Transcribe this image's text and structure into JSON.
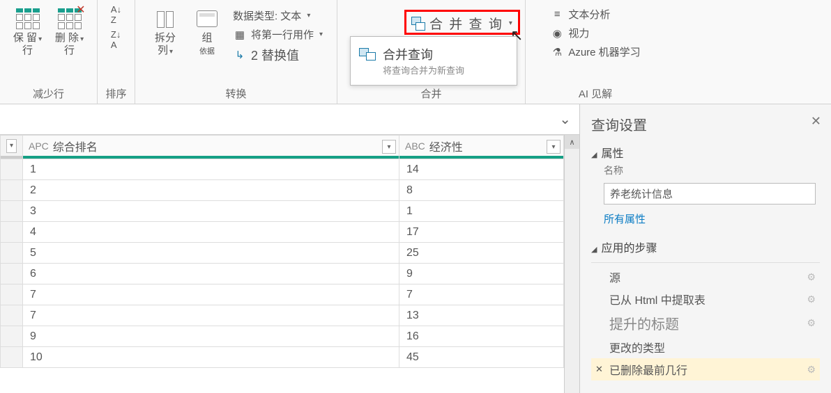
{
  "ribbon": {
    "groups": {
      "reduce": {
        "keep_rows": "保 留",
        "remove_rows": "删 除",
        "row_suffix": "行",
        "label": "减少行"
      },
      "sort": {
        "label": "排序"
      },
      "columns": {
        "split": "拆分",
        "col": "列",
        "group": "组",
        "group_suffix": "依据"
      },
      "transform": {
        "datatype": "数据类型: 文本",
        "first_row": "将第一行用作",
        "replace": "2 替换值",
        "label": "转换"
      },
      "merge": {
        "btn": "合 并 查 询",
        "dd_title": "合并查询",
        "dd_sub": "将查询合并为新查询",
        "label": "合并"
      },
      "ai": {
        "text_analysis": "文本分析",
        "vision": "视力",
        "azure_ml": "Azure 机器学习",
        "label": "AI 见解"
      }
    }
  },
  "table": {
    "columns": [
      {
        "type": "APC",
        "name": "综合排名"
      },
      {
        "type": "ABC",
        "name": "经济性"
      }
    ],
    "rows": [
      {
        "c1": "1",
        "c2": "14"
      },
      {
        "c1": "2",
        "c2": "8"
      },
      {
        "c1": "3",
        "c2": "1"
      },
      {
        "c1": "4",
        "c2": "17"
      },
      {
        "c1": "5",
        "c2": "25"
      },
      {
        "c1": "6",
        "c2": "9"
      },
      {
        "c1": "7",
        "c2": "7"
      },
      {
        "c1": "7",
        "c2": "13"
      },
      {
        "c1": "9",
        "c2": "16"
      },
      {
        "c1": "10",
        "c2": "45"
      }
    ]
  },
  "panel": {
    "title": "查询设置",
    "props": "属性",
    "name_lbl": "名称",
    "name_val": "养老统计信息",
    "all_props": "所有属性",
    "steps_lbl": "应用的步骤",
    "steps": [
      {
        "label": "源",
        "gear": true
      },
      {
        "label": "已从 Html 中提取表",
        "gear": true
      },
      {
        "label": "提升的标题",
        "big": true,
        "gear": true
      },
      {
        "label": "更改的类型"
      },
      {
        "label": "已删除最前几行",
        "sel": true,
        "gear": true
      }
    ]
  }
}
